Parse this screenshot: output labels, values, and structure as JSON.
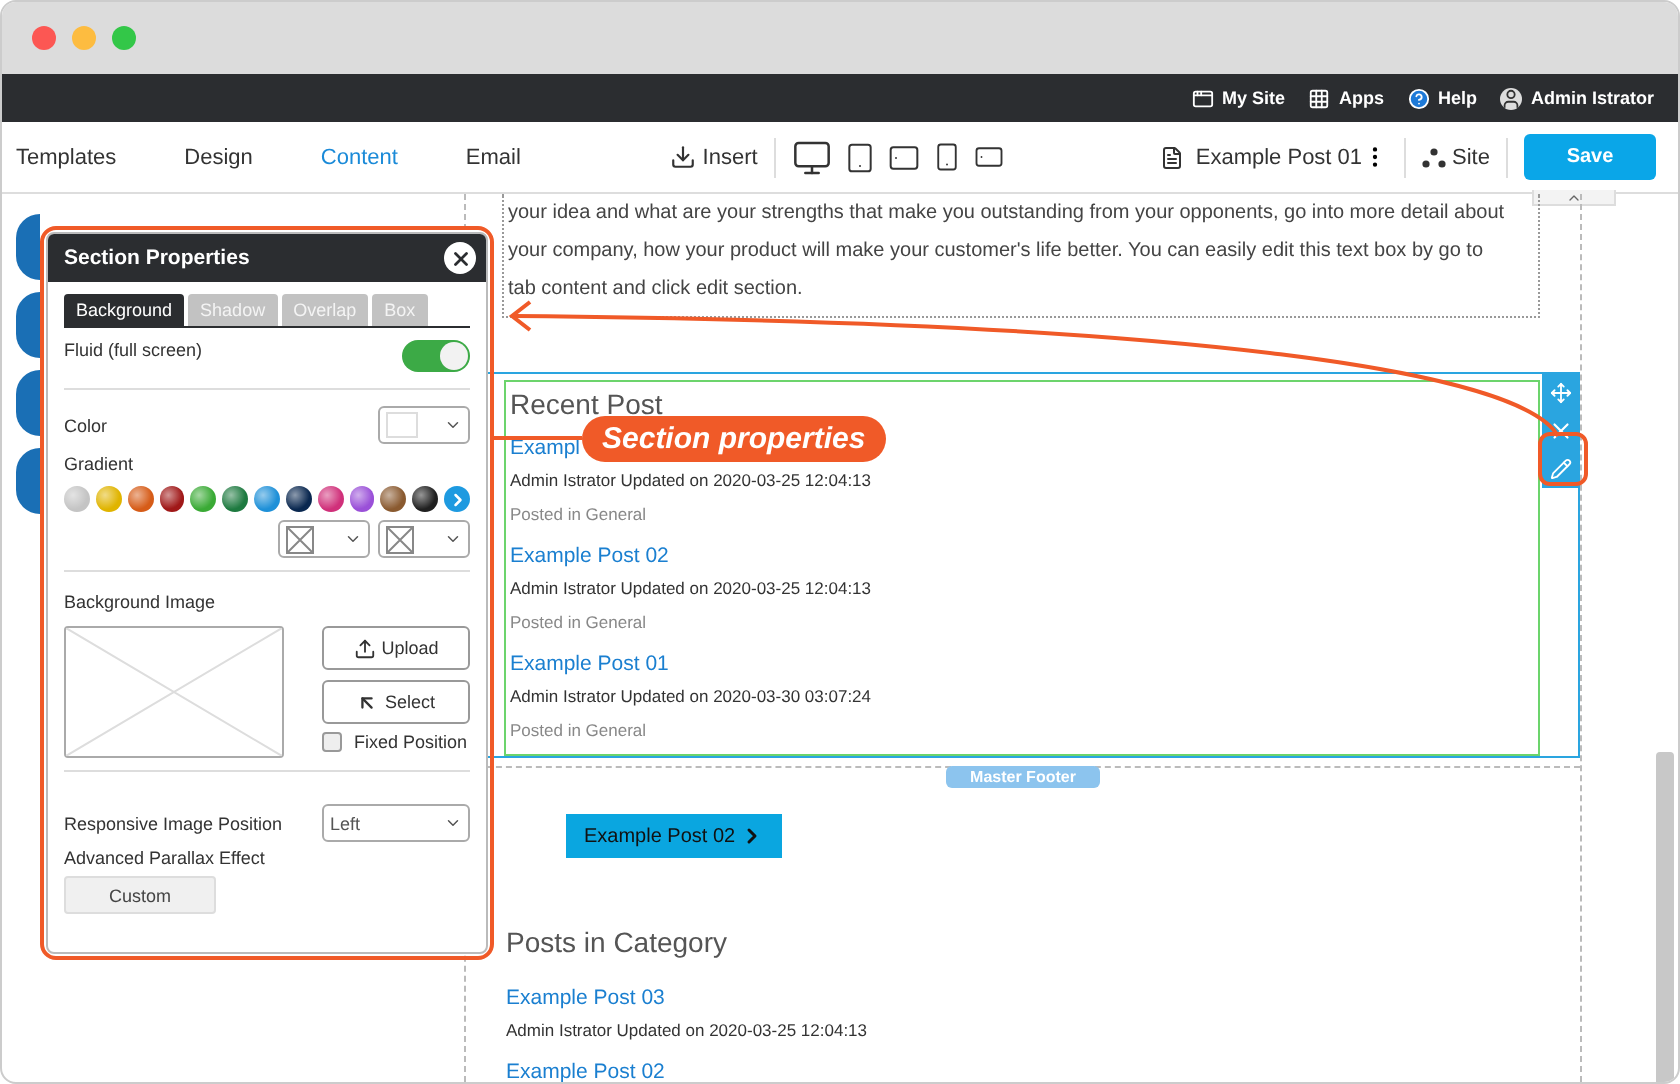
{
  "top_bar": {
    "items": [
      {
        "kind": "site",
        "label": "My Site"
      },
      {
        "kind": "apps",
        "label": "Apps"
      },
      {
        "kind": "help",
        "label": "Help"
      },
      {
        "kind": "user",
        "label": "Admin Istrator"
      }
    ]
  },
  "toolbar": {
    "tabs": [
      {
        "label": "Templates",
        "selected": false
      },
      {
        "label": "Design",
        "selected": false
      },
      {
        "label": "Content",
        "selected": true
      },
      {
        "label": "Email",
        "selected": false
      }
    ],
    "insert": "Insert",
    "devices": [
      {
        "kind": "desktop"
      },
      {
        "kind": "tablet"
      },
      {
        "kind": "tablet-landscape"
      },
      {
        "kind": "phone"
      },
      {
        "kind": "phone-landscape"
      }
    ],
    "page": "Example Post 01",
    "site": "Site",
    "save": "Save"
  },
  "canvas": {
    "intro_text": "your idea and what are your strengths that make you outstanding from your opponents, go into more detail about your company, how your product will make your customer's life better. You can easily edit this text box by go to tab content and click edit section.",
    "recent": {
      "title": "Recent Post",
      "posts": [
        {
          "title": "Exampl",
          "meta": "Admin Istrator Updated on 2020-03-25 12:04:13",
          "category": "Posted in General"
        },
        {
          "title": "Example Post 02",
          "meta": "Admin Istrator Updated on 2020-03-25 12:04:13",
          "category": "Posted in General"
        },
        {
          "title": "Example Post 01",
          "meta": "Admin Istrator Updated on 2020-03-30 03:07:24",
          "category": "Posted in General"
        }
      ]
    },
    "footer_label": "Master Footer",
    "nav_button": "Example Post 02",
    "category": {
      "title": "Posts in Category",
      "posts": [
        {
          "title": "Example Post 03",
          "meta": "Admin Istrator Updated on 2020-03-25 12:04:13"
        },
        {
          "title": "Example Post 02"
        }
      ]
    }
  },
  "panel": {
    "title": "Section Properties",
    "tabs": [
      {
        "label": "Background",
        "selected": true
      },
      {
        "label": "Shadow",
        "selected": false
      },
      {
        "label": "Overlap",
        "selected": false
      },
      {
        "label": "Box",
        "selected": false
      }
    ],
    "fluid": {
      "label": "Fluid (full screen)",
      "on": true
    },
    "color_label": "Color",
    "gradient_label": "Gradient",
    "gradients": [
      {
        "color": "#c4c4c4"
      },
      {
        "color": "#e0b400"
      },
      {
        "color": "#d65c18"
      },
      {
        "color": "#a01818"
      },
      {
        "color": "#3aaa35"
      },
      {
        "color": "#1e7a40"
      },
      {
        "color": "#1e90d8"
      },
      {
        "color": "#0a2850"
      },
      {
        "color": "#d0307a"
      },
      {
        "color": "#9a50d8"
      },
      {
        "color": "#8a5a30"
      },
      {
        "color": "#202020"
      }
    ],
    "background_image_label": "Background Image",
    "upload": "Upload",
    "select": "Select",
    "fixed_position": {
      "label": "Fixed Position",
      "checked": false
    },
    "responsive_label": "Responsive Image Position",
    "responsive_value": "Left",
    "parallax_label": "Advanced Parallax Effect",
    "custom": "Custom"
  },
  "annotation": {
    "callout": "Section properties"
  }
}
